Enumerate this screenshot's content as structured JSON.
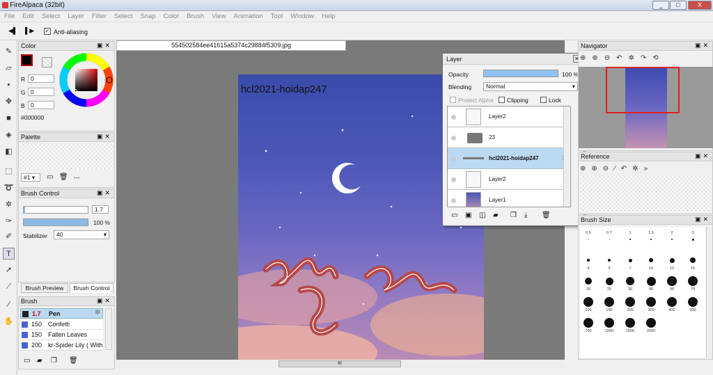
{
  "window": {
    "title": "FireAlpaca (32bit)",
    "min": "_",
    "max": "□",
    "close": "X"
  },
  "menu": [
    "File",
    "Edit",
    "Select",
    "Layer",
    "Filter",
    "Select",
    "Snap",
    "Color",
    "Brush",
    "View",
    "Animation",
    "Tool",
    "Window",
    "Help"
  ],
  "options": {
    "prev": "◀▌",
    "next": "▌▶",
    "checkmark": "✓",
    "anti_aliasing": "Anti-aliasing"
  },
  "color_panel": {
    "title": "Color",
    "r_label": "R",
    "g_label": "G",
    "b_label": "B",
    "r": "0",
    "g": "0",
    "b": "0",
    "hex": "#000000",
    "primary_color": "#000000",
    "accent_red": "#c00000"
  },
  "palette_panel": {
    "title": "Palette",
    "set_label": "#1",
    "dashes": "---"
  },
  "brush_control": {
    "title": "Brush Control",
    "size": "1.7",
    "opacity": "100 %",
    "stabilizer_label": "Stabilizer",
    "stabilizer": "40",
    "opacity_fraction": 1.0
  },
  "brush_tabs": {
    "preview": "Brush Preview",
    "control": "Brush Control"
  },
  "brush_panel": {
    "title": "Brush",
    "items": [
      {
        "size": "1.7",
        "name": "Pen"
      },
      {
        "size": "150",
        "name": "Confetti"
      },
      {
        "size": "150",
        "name": "Fallen Leaves"
      },
      {
        "size": "200",
        "name": "kr-Spider Lily ( With"
      }
    ]
  },
  "document": {
    "filename": "554502584ee41615a5374c29884f5309.jpg",
    "canvas_text": "hcl2021-hoidap247",
    "scroll_grip": "III"
  },
  "layer_panel": {
    "title": "Layer",
    "opacity_label": "Opacity",
    "opacity": "100 %",
    "opacity_fraction": 1.0,
    "blending_label": "Blending",
    "blending": "Normal",
    "protect_alpha": "Protect Alpha",
    "clipping": "Clipping",
    "lock": "Lock",
    "layers": [
      "Layer2",
      "23",
      "hcl2021-hoidap247",
      "Layer2",
      "Layer1"
    ],
    "selected_layer_color": "#bcd9f2"
  },
  "navigator": {
    "title": "Navigator"
  },
  "reference": {
    "title": "Reference"
  },
  "brush_size": {
    "title": "Brush Size",
    "sizes": [
      "0.5",
      "0.7",
      "1",
      "1.5",
      "2",
      "3",
      "4",
      "5",
      "7",
      "10",
      "12",
      "15",
      "20",
      "25",
      "30",
      "40",
      "50",
      "70",
      "100",
      "150",
      "200",
      "300",
      "400",
      "500",
      "700",
      "1000",
      "1500",
      "2000"
    ]
  }
}
